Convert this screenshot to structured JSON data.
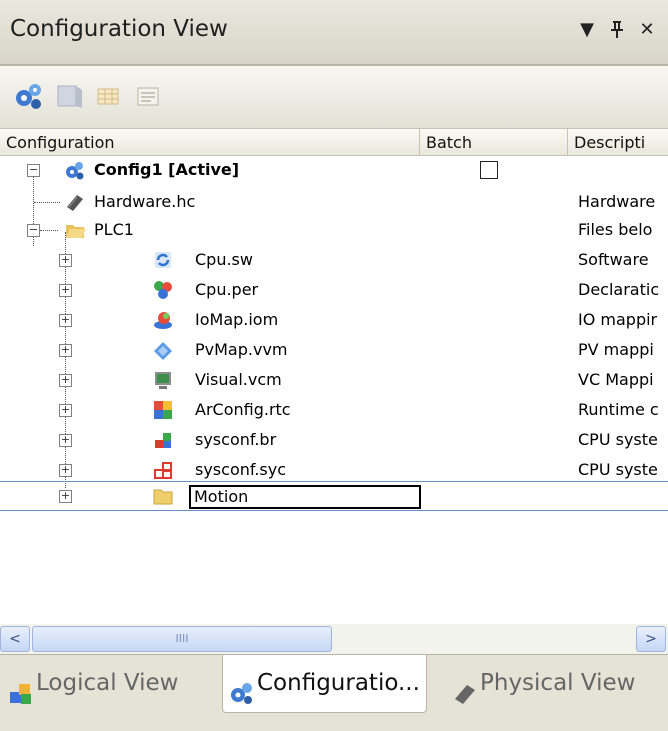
{
  "window": {
    "title": "Configuration View",
    "controls": {
      "dropdown": "▼",
      "pin": "ᵽ",
      "close": "✕"
    }
  },
  "toolbar": {
    "buttons": [
      {
        "name": "configuration-icon"
      },
      {
        "name": "cube-icon"
      },
      {
        "name": "table-icon"
      },
      {
        "name": "properties-icon"
      }
    ]
  },
  "columns": {
    "configuration": "Configuration",
    "batch": "Batch",
    "description": "Descripti"
  },
  "tree": {
    "root": {
      "label": "Config1 [Active]",
      "expander": "−"
    },
    "items": [
      {
        "label": "Hardware.hc",
        "desc": "Hardware",
        "icon": "hardware-icon"
      },
      {
        "label": "PLC1",
        "desc": "Files belo",
        "icon": "folder-open-icon",
        "expander": "−"
      },
      {
        "label": "Cpu.sw",
        "desc": "Software",
        "icon": "software-icon",
        "expander": "+"
      },
      {
        "label": "Cpu.per",
        "desc": "Declaratic",
        "icon": "permanent-vars-icon",
        "expander": "+"
      },
      {
        "label": "IoMap.iom",
        "desc": "IO mappir",
        "icon": "io-map-icon",
        "expander": "+"
      },
      {
        "label": "PvMap.vvm",
        "desc": "PV mappi",
        "icon": "pv-map-icon",
        "expander": "+"
      },
      {
        "label": "Visual.vcm",
        "desc": "VC Mappi",
        "icon": "visual-icon",
        "expander": "+"
      },
      {
        "label": "ArConfig.rtc",
        "desc": "Runtime c",
        "icon": "runtime-config-icon",
        "expander": "+"
      },
      {
        "label": "sysconf.br",
        "desc": "CPU syste",
        "icon": "sysconf-br-icon",
        "expander": "+"
      },
      {
        "label": "sysconf.syc",
        "desc": "CPU syste",
        "icon": "sysconf-syc-icon",
        "expander": "+"
      }
    ],
    "rename": {
      "value": "Motion",
      "expander": "+"
    }
  },
  "scrollbar": {
    "left": "<",
    "right": ">",
    "grip": "IIII"
  },
  "tabs": [
    {
      "label": "Logical View",
      "active": false
    },
    {
      "label": "Configuratio...",
      "active": true
    },
    {
      "label": "Physical View",
      "active": false
    }
  ],
  "colors": {
    "accent": "#3a6fbf",
    "selection_border": "#6b8ec8",
    "panel": "#e5e2d6"
  }
}
